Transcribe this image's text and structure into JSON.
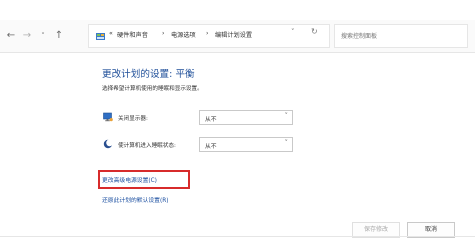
{
  "address_bar": {
    "back_icon": "back-arrow-icon",
    "forward_icon": "forward-arrow-icon",
    "history_icon": "chevron-down-icon",
    "up_icon": "up-arrow-icon",
    "breadcrumb": {
      "prefix": "«",
      "items": [
        "硬件和声音",
        "电源选项",
        "编辑计划设置"
      ],
      "separator": "›"
    },
    "refresh_icon": "refresh-icon",
    "search_placeholder": "搜索控制面板"
  },
  "main": {
    "title": "更改计划的设置: 平衡",
    "subtitle": "选择希望计算机使用的睡眠和显示设置。",
    "settings": [
      {
        "label": "关闭显示器:",
        "value": "从不",
        "icon": "monitor-icon"
      },
      {
        "label": "使计算机进入睡眠状态:",
        "value": "从不",
        "icon": "sleep-moon-icon"
      }
    ],
    "links": {
      "advanced": "更改高级电源设置(C)",
      "restore": "还原此计划的默认设置(R)"
    }
  },
  "footer": {
    "save_label": "保存修改",
    "cancel_label": "取消"
  },
  "colors": {
    "title_blue": "#1e4e99",
    "link_blue": "#1a4ea0",
    "highlight_red": "#d72b2b"
  }
}
